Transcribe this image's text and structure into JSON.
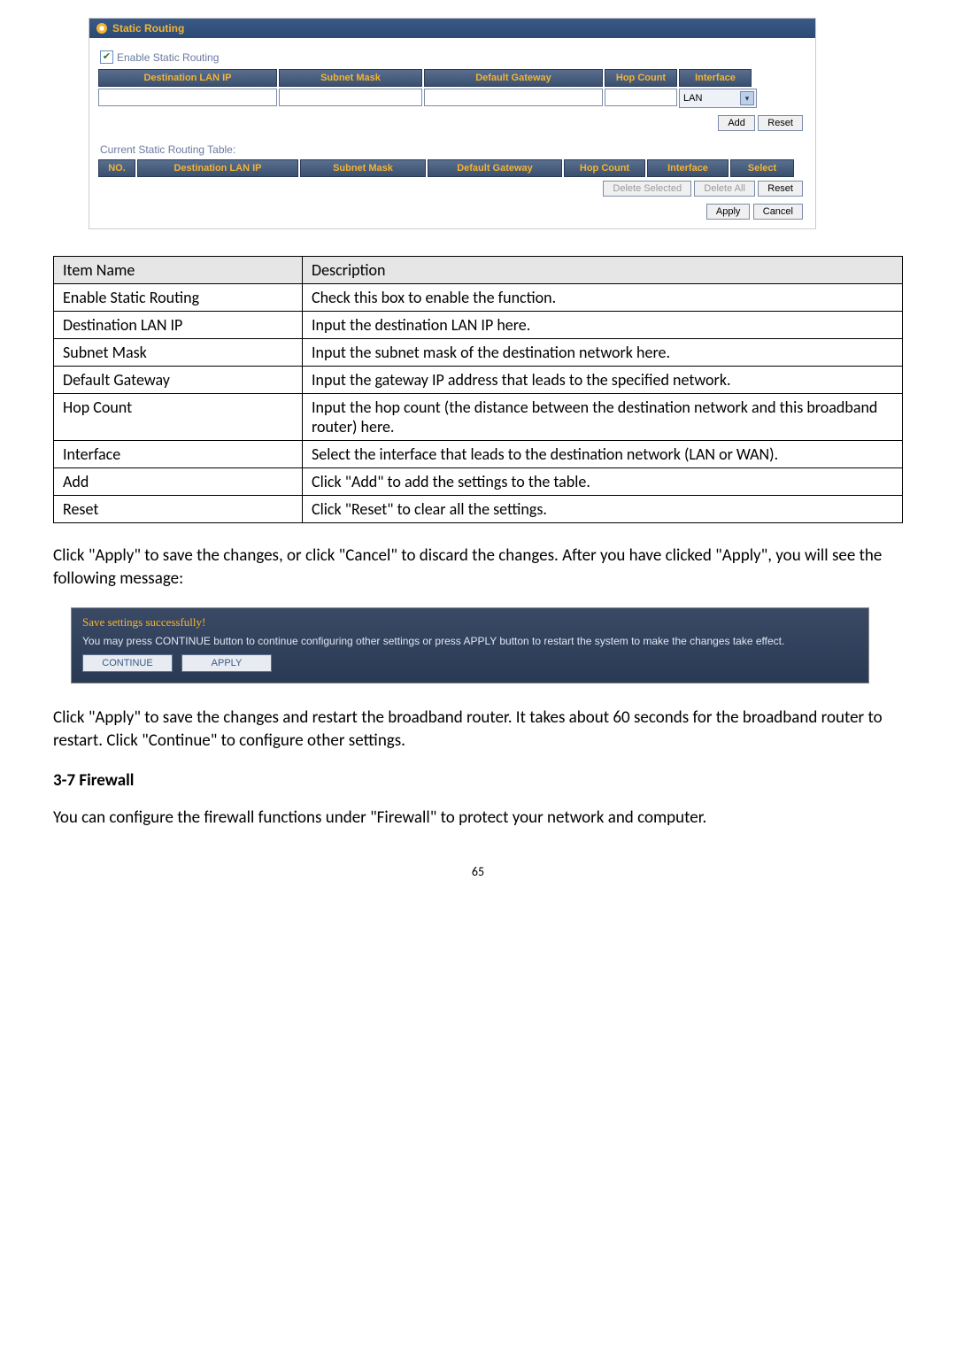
{
  "ui1": {
    "title": "Static Routing",
    "enable_label": "Enable Static Routing",
    "cols": {
      "dest": "Destination LAN IP",
      "subnet": "Subnet Mask",
      "gw": "Default Gateway",
      "hop": "Hop Count",
      "iface": "Interface"
    },
    "iface_value": "LAN",
    "btn_add": "Add",
    "btn_reset": "Reset",
    "table2_label": "Current Static Routing Table:",
    "cols2": {
      "no": "NO.",
      "dest": "Destination LAN IP",
      "subnet": "Subnet Mask",
      "gw": "Default Gateway",
      "hop": "Hop Count",
      "iface": "Interface",
      "select": "Select"
    },
    "btn_del_sel": "Delete Selected",
    "btn_del_all": "Delete All",
    "btn_reset2": "Reset",
    "btn_apply": "Apply",
    "btn_cancel": "Cancel"
  },
  "desc_table": {
    "head_item": "Item Name",
    "head_desc": "Description",
    "rows": [
      {
        "item": "Enable Static Routing",
        "desc": "Check this box to enable the function."
      },
      {
        "item": "Destination LAN IP",
        "desc": "Input the destination LAN IP here."
      },
      {
        "item": "Subnet Mask",
        "desc": "Input the subnet mask of the destination network here."
      },
      {
        "item": "Default Gateway",
        "desc": "Input the gateway IP address that leads to the specified network."
      },
      {
        "item": "Hop Count",
        "desc": "Input the hop count (the distance between the destination network and this broadband router) here."
      },
      {
        "item": "Interface",
        "desc": "Select the interface that leads to the destination network (LAN or WAN)."
      },
      {
        "item": "Add",
        "desc": "Click \"Add\" to add the settings to the table."
      },
      {
        "item": "Reset",
        "desc": "Click \"Reset\" to clear all the settings."
      }
    ]
  },
  "para1": "Click \"Apply\" to save the changes, or click \"Cancel\" to discard the changes. After you have clicked \"Apply\", you will see the following message:",
  "savebox": {
    "title": "Save settings successfully!",
    "text": "You may press CONTINUE button to continue configuring other settings or press APPLY button to restart the system to make the changes take effect.",
    "btn_continue": "CONTINUE",
    "btn_apply": "APPLY"
  },
  "para2": "Click \"Apply\" to save the changes and restart the broadband router. It takes about 60 seconds for the broadband router to restart. Click \"Continue\" to configure other settings.",
  "heading": "3-7 Firewall",
  "para3": "You can configure the firewall functions under \"Firewall\" to protect your network and computer.",
  "page_number": "65"
}
